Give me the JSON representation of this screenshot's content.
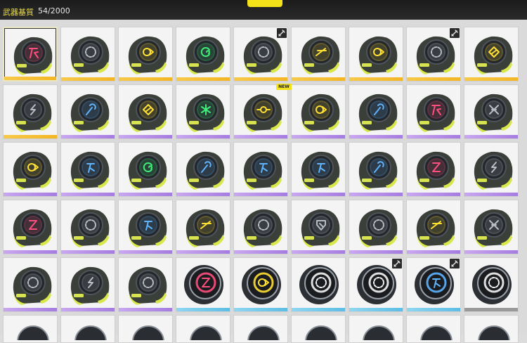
{
  "header": {
    "title": "武器基質",
    "count": "54/2000"
  },
  "badges": {
    "new": "NEW"
  },
  "grid": {
    "rows": [
      [
        {
          "icon": "cross-rune-icon",
          "glyph": "red",
          "rarity": "gold",
          "selected": true
        },
        {
          "icon": "ring-icon",
          "glyph": "gray",
          "rarity": "gold"
        },
        {
          "icon": "arrow-loop-icon",
          "glyph": "yellow",
          "rarity": "gold"
        },
        {
          "icon": "spiral-icon",
          "glyph": "green",
          "rarity": "gold"
        },
        {
          "icon": "ring-icon",
          "glyph": "gray",
          "rarity": "gold",
          "weapon_tag": true
        },
        {
          "icon": "chevron-icon",
          "glyph": "yellow",
          "rarity": "gold"
        },
        {
          "icon": "arrow-loop-icon",
          "glyph": "yellow",
          "rarity": "gold"
        },
        {
          "icon": "ring-icon",
          "glyph": "gray",
          "rarity": "gold",
          "weapon_tag": true
        },
        {
          "icon": "diamond-icon",
          "glyph": "yellow",
          "rarity": "gold"
        }
      ],
      [
        {
          "icon": "lightning-icon",
          "glyph": "gray",
          "rarity": "gold"
        },
        {
          "icon": "wand-icon",
          "glyph": "blue",
          "rarity": "purple"
        },
        {
          "icon": "diamond-icon",
          "glyph": "yellow",
          "rarity": "purple"
        },
        {
          "icon": "star-icon",
          "glyph": "green",
          "rarity": "purple"
        },
        {
          "icon": "target-icon",
          "glyph": "yellow",
          "rarity": "purple",
          "new": true
        },
        {
          "icon": "arrow-loop-icon",
          "glyph": "yellow",
          "rarity": "purple"
        },
        {
          "icon": "wand-icon",
          "glyph": "blue",
          "rarity": "purple"
        },
        {
          "icon": "cross-rune-icon",
          "glyph": "red",
          "rarity": "purple"
        },
        {
          "icon": "cross-x-icon",
          "glyph": "gray",
          "rarity": "purple"
        }
      ],
      [
        {
          "icon": "arrow-loop-icon",
          "glyph": "yellow",
          "rarity": "purple"
        },
        {
          "icon": "runner-icon",
          "glyph": "blue",
          "rarity": "purple"
        },
        {
          "icon": "spiral-icon",
          "glyph": "green",
          "rarity": "purple"
        },
        {
          "icon": "wand-icon",
          "glyph": "blue",
          "rarity": "purple"
        },
        {
          "icon": "runner-icon",
          "glyph": "blue",
          "rarity": "purple"
        },
        {
          "icon": "runner-icon",
          "glyph": "blue",
          "rarity": "purple"
        },
        {
          "icon": "wand-icon",
          "glyph": "blue",
          "rarity": "purple"
        },
        {
          "icon": "zigzag-icon",
          "glyph": "red",
          "rarity": "purple"
        },
        {
          "icon": "lightning-icon",
          "glyph": "gray",
          "rarity": "purple"
        }
      ],
      [
        {
          "icon": "zigzag-icon",
          "glyph": "red",
          "rarity": "purple"
        },
        {
          "icon": "ring-icon",
          "glyph": "gray",
          "rarity": "purple"
        },
        {
          "icon": "runner-icon",
          "glyph": "blue",
          "rarity": "purple"
        },
        {
          "icon": "chevron-icon",
          "glyph": "yellow",
          "rarity": "purple"
        },
        {
          "icon": "ring-icon",
          "glyph": "gray",
          "rarity": "purple"
        },
        {
          "icon": "shield-icon",
          "glyph": "gray",
          "rarity": "purple"
        },
        {
          "icon": "ring-icon",
          "glyph": "gray",
          "rarity": "purple"
        },
        {
          "icon": "chevron-icon",
          "glyph": "yellow",
          "rarity": "purple"
        },
        {
          "icon": "cross-x-icon",
          "glyph": "gray",
          "rarity": "purple"
        }
      ],
      [
        {
          "icon": "ring-icon",
          "glyph": "gray",
          "rarity": "purple"
        },
        {
          "icon": "lightning-icon",
          "glyph": "gray",
          "rarity": "purple"
        },
        {
          "icon": "ring-icon",
          "glyph": "gray",
          "rarity": "purple"
        },
        {
          "icon": "zigzag-icon",
          "glyph": "red",
          "rarity": "blue",
          "round": true
        },
        {
          "icon": "arrow-loop-icon",
          "glyph": "yellow",
          "rarity": "blue",
          "round": true
        },
        {
          "icon": "ring-icon",
          "glyph": "white",
          "rarity": "blue",
          "round": true
        },
        {
          "icon": "ring-icon",
          "glyph": "white",
          "rarity": "blue",
          "round": true,
          "weapon_tag": true
        },
        {
          "icon": "runner-icon",
          "glyph": "blue",
          "rarity": "blue",
          "round": true,
          "weapon_tag": true
        },
        {
          "icon": "ring-icon",
          "glyph": "white",
          "rarity": "gray",
          "round": true
        }
      ]
    ]
  },
  "colors": {
    "gold": "#f4b623",
    "purple": "#a57ce0",
    "blue": "#5cbde4",
    "gray": "#9a9a9a",
    "glyph_red": "#ff4f7e",
    "glyph_yellow": "#ffe033",
    "glyph_blue": "#5fb4ff",
    "glyph_green": "#3ef07a",
    "glyph_gray": "#b8bcc4",
    "glyph_white": "#f4f4f4",
    "shell_accent": "#d8e84a"
  }
}
